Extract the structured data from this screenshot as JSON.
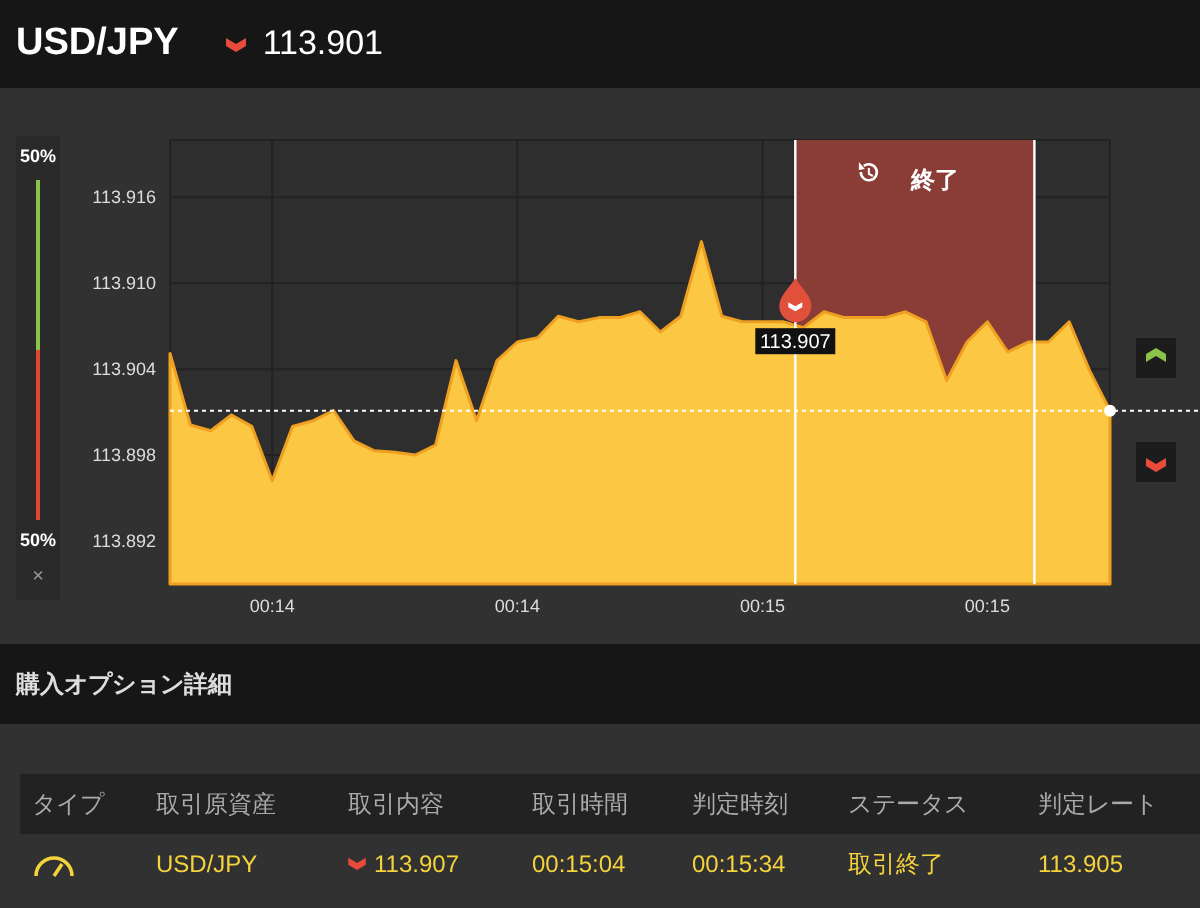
{
  "header": {
    "symbol": "USD/JPY",
    "kind": "down",
    "price": "113.901"
  },
  "meter": {
    "up_label": "50%",
    "down_label": "50%",
    "level": 0.5,
    "close": "×"
  },
  "chart": {
    "expiry_label": "終了",
    "entry_label": "113.907",
    "chart_data": {
      "type": "area",
      "categories": [
        null,
        null,
        null,
        null,
        null,
        "00:14",
        null,
        null,
        null,
        null,
        null,
        null,
        null,
        null,
        null,
        null,
        null,
        "00:14",
        null,
        null,
        null,
        null,
        null,
        null,
        null,
        null,
        null,
        null,
        null,
        "00:15",
        null,
        null,
        null,
        null,
        null,
        null,
        null,
        null,
        null,
        null,
        "00:15",
        null,
        null,
        null,
        null,
        null,
        null
      ],
      "values": [
        113.9051,
        113.9001,
        113.8997,
        113.9008,
        113.9,
        113.8962,
        113.9,
        113.9004,
        113.9011,
        113.899,
        113.8983,
        113.8982,
        113.898,
        113.8987,
        113.9046,
        113.9004,
        113.9046,
        113.9059,
        113.9062,
        113.9077,
        113.9073,
        113.9076,
        113.9076,
        113.908,
        113.9066,
        113.9077,
        113.9129,
        113.9077,
        113.9073,
        113.9073,
        113.9073,
        113.9069,
        113.908,
        113.9076,
        113.9076,
        113.9076,
        113.908,
        113.9073,
        113.9032,
        113.9059,
        113.9073,
        113.9052,
        113.9059,
        113.9059,
        113.9073,
        113.9039,
        113.9011
      ],
      "ylim": [
        113.889,
        113.92
      ],
      "grid": true,
      "ref_lines": [
        {
          "axis": "y",
          "value": 113.9011
        }
      ],
      "yticks": [
        {
          "value": 113.892,
          "label": "113.892"
        },
        {
          "value": 113.898,
          "label": "113.898"
        },
        {
          "value": 113.904,
          "label": "113.904"
        },
        {
          "value": 113.91,
          "label": "113.910"
        },
        {
          "value": 113.916,
          "label": "113.916"
        }
      ]
    }
  },
  "section_title": "購入オプション詳細",
  "table": {
    "columns": [
      "タイプ",
      "取引原資産",
      "取引内容",
      "取引時間",
      "判定時刻",
      "ステータス",
      "判定レート"
    ],
    "rows": [
      {
        "asset": "USD/JPY",
        "kind": "down",
        "price": "113.907",
        "trade_time": "00:15:04",
        "judge_time": "00:15:34",
        "status": "取引終了",
        "rate": "113.905"
      }
    ]
  }
}
